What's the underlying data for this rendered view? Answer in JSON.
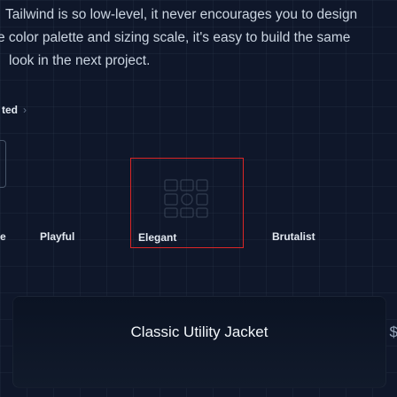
{
  "intro": {
    "line1": "Tailwind is so low-level, it never encourages you to design",
    "line2": "e color palette and sizing scale, it's easy to build the same",
    "line3": "look in the next project."
  },
  "breadcrumb": {
    "label": "ted",
    "chevron": "›"
  },
  "themes": [
    {
      "label": "e"
    },
    {
      "label": "Playful"
    },
    {
      "label": "Elegant",
      "selected": true
    },
    {
      "label": "Brutalist"
    }
  ],
  "colors": {
    "selected_border": "#dc2626",
    "background": "#0f172a"
  },
  "icons": {
    "elegant": "grid-shapes-icon"
  },
  "product": {
    "title": "Classic Utility Jacket",
    "price_fragment": "$"
  }
}
